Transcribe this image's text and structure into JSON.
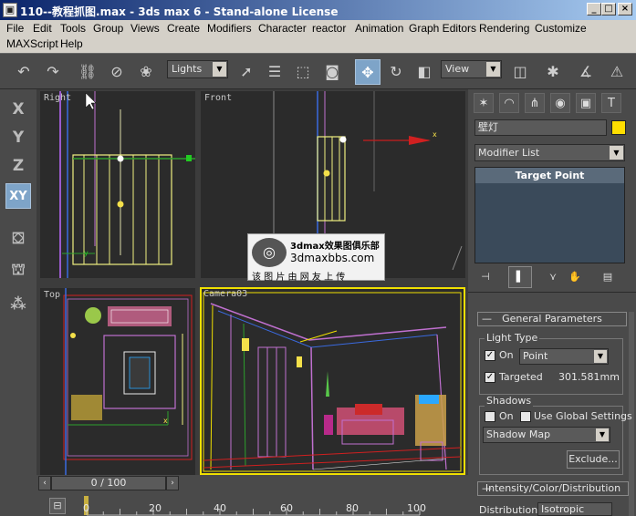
{
  "window": {
    "app_icon": "max-logo-icon",
    "title": "110--教程抓图.max - 3ds max 6 - Stand-alone License",
    "controls": [
      "_",
      "□",
      "×"
    ]
  },
  "menu": {
    "items": [
      "File",
      "Edit",
      "Tools",
      "Group",
      "Views",
      "Create",
      "Modifiers",
      "Character",
      "reactor",
      "Animation",
      "Graph Editors",
      "Rendering",
      "Customize",
      "MAXScript",
      "Help"
    ]
  },
  "toolbar": {
    "selection_filter": "Lights",
    "reference_coord": "View"
  },
  "axis_constraints": {
    "x": "X",
    "y": "Y",
    "z": "Z",
    "xy": "XY"
  },
  "viewports": {
    "right": "Right",
    "front": "Front",
    "top": "Top",
    "camera": "Camera03"
  },
  "watermark": {
    "line1": "3dmax效果图俱乐部",
    "line2": "3dmaxbbs.com",
    "line3": "该 图 片 由 网 友 上 传"
  },
  "command_panel": {
    "object_name": "壁灯",
    "object_color": "#ffde00",
    "modifier_list": "Modifier List",
    "stack_item": "Target Point",
    "general_params": {
      "title": "General Parameters",
      "light_type_group": "Light Type",
      "on_label": "On",
      "on_checked": true,
      "type_value": "Point",
      "targeted_label": "Targeted",
      "targeted_checked": true,
      "target_distance": "301.581mm",
      "shadows_group": "Shadows",
      "shadows_on_label": "On",
      "shadows_on_checked": false,
      "use_global_label": "Use Global Settings",
      "use_global_checked": false,
      "shadow_type": "Shadow Map",
      "exclude_button": "Exclude..."
    },
    "intensity_rollout": {
      "title": "Intensity/Color/Distribution",
      "distribution_label": "Distribution:",
      "distribution_value": "Isotropic"
    }
  },
  "timeline": {
    "frame_display": "0 / 100",
    "ticks": [
      "0",
      "20",
      "40",
      "60",
      "80",
      "100"
    ]
  }
}
